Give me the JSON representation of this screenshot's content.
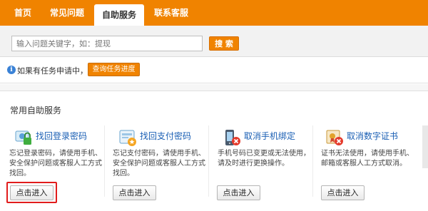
{
  "nav": {
    "tabs": [
      {
        "label": "首页",
        "active": false
      },
      {
        "label": "常见问题",
        "active": false
      },
      {
        "label": "自助服务",
        "active": true
      },
      {
        "label": "联系客服",
        "active": false
      }
    ]
  },
  "search": {
    "placeholder": "输入问题关键字，如：提现",
    "button_label": "搜 索"
  },
  "task": {
    "text": "如果有任务申请中，可",
    "button_label": "查询任务进度"
  },
  "panel": {
    "title": "常用自助服务",
    "cards": [
      {
        "icon": "lock-icon",
        "link": "找回登录密码",
        "desc": "忘记登录密码，请使用手机、安全保护问题或客服人工方式找回。",
        "button": "点击进入",
        "highlighted": true
      },
      {
        "icon": "payment-password-icon",
        "link": "找回支付密码",
        "desc": "忘记支付密码，请使用手机、安全保护问题或客服人工方式找回。",
        "button": "点击进入",
        "highlighted": false
      },
      {
        "icon": "mobile-unbind-icon",
        "link": "取消手机绑定",
        "desc": "手机号码已变更或无法使用，请及时进行更换操作。",
        "button": "点击进入",
        "highlighted": false
      },
      {
        "icon": "certificate-cancel-icon",
        "link": "取消数字证书",
        "desc": "证书无法使用，请使用手机、邮箱或客服人工方式取消。",
        "button": "点击进入",
        "highlighted": false
      }
    ]
  },
  "colors": {
    "accent": "#f08300",
    "link": "#1a5fb4",
    "highlight": "#e11c1c"
  }
}
